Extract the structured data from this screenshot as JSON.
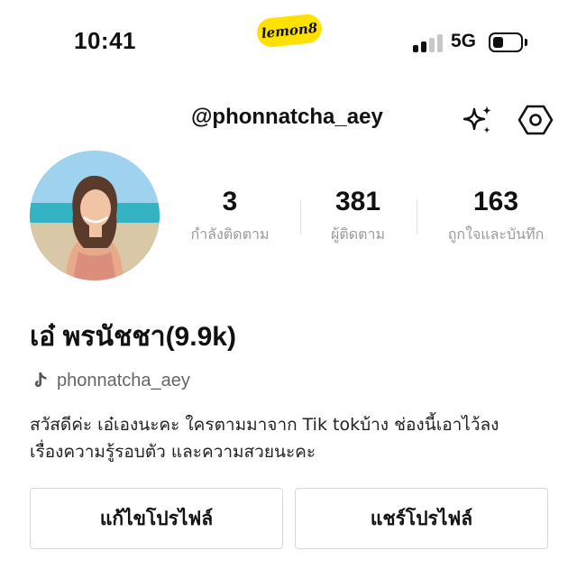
{
  "status_bar": {
    "time": "10:41",
    "app_logo_text": "lemon8",
    "network": "5G",
    "signal_bars": 4,
    "signal_bars_active": 2,
    "battery_level": 0.35
  },
  "header": {
    "username": "@phonnatcha_aey",
    "icons": [
      "sparkle-icon",
      "settings-icon"
    ]
  },
  "profile": {
    "avatar": "avatar-photo",
    "stats": [
      {
        "value": "3",
        "label": "กำลังติดตาม"
      },
      {
        "value": "381",
        "label": "ผู้ติดตาม"
      },
      {
        "value": "163",
        "label": "ถูกใจและบันทึก"
      }
    ],
    "display_name": "เอ๋ พรนัชชา(9.9k)",
    "tiktok_handle": "phonnatcha_aey",
    "bio_line1": "สวัสดีค่ะ เอ๋เองนะคะ ใครตามมาจาก Tik tokบ้าง ช่องนี้เอาไว้ลง",
    "bio_line2": "เรื่องความรู้รอบตัว และความสวยนะคะ"
  },
  "actions": {
    "edit_profile": "แก้ไขโปรไฟล์",
    "share_profile": "แชร์โปรไฟล์"
  },
  "colors": {
    "brand_yellow": "#ffe100",
    "muted_text": "#9a9a9a",
    "border": "#d8d8d8"
  }
}
